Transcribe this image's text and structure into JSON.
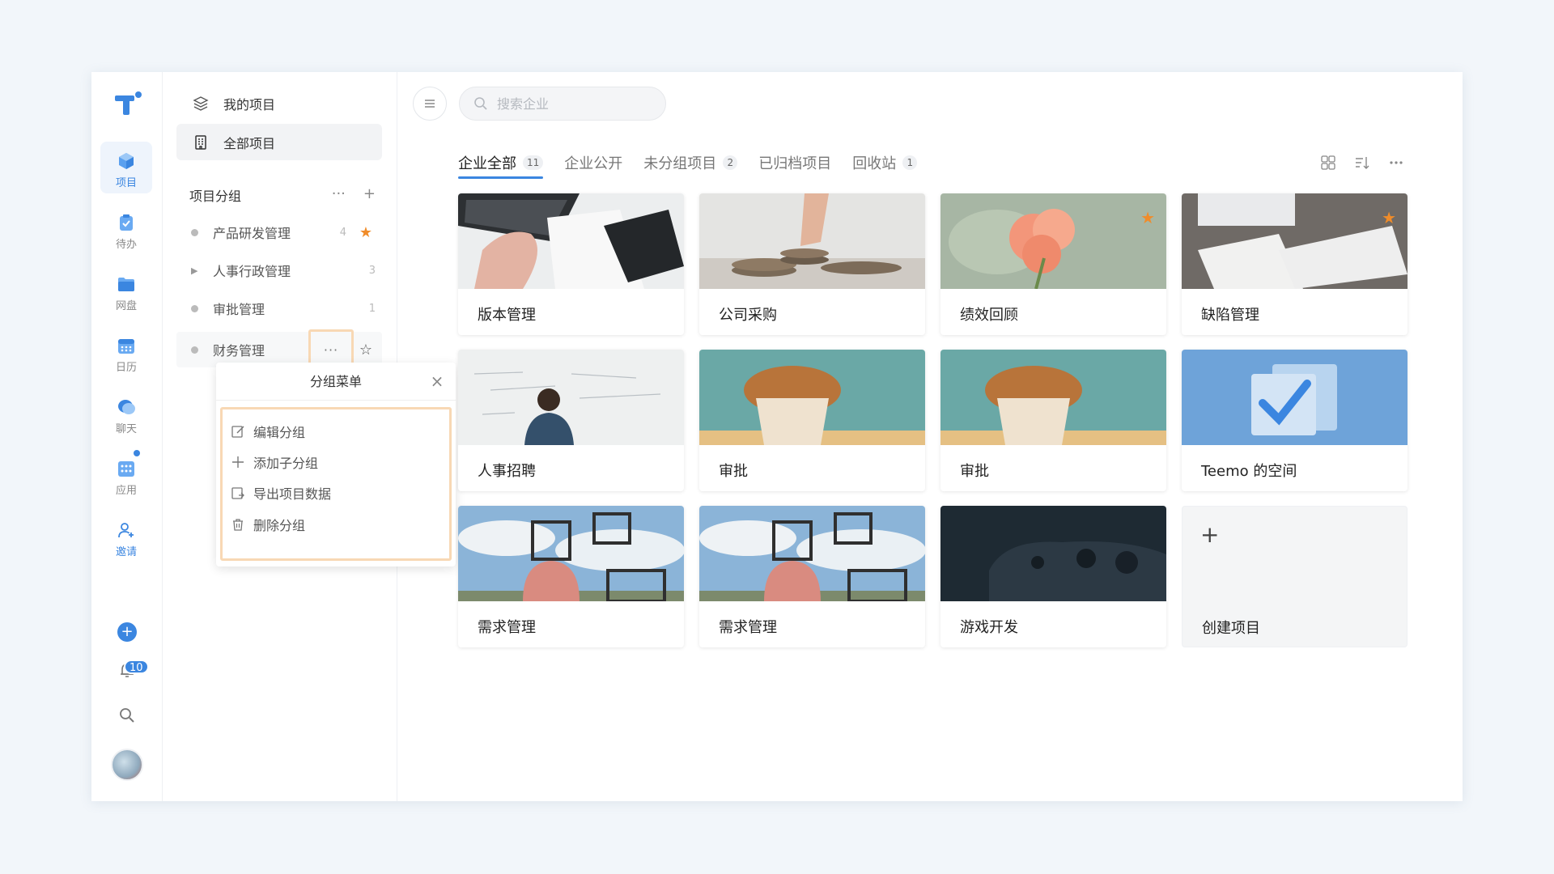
{
  "rail": {
    "items": [
      {
        "label": "项目"
      },
      {
        "label": "待办"
      },
      {
        "label": "网盘"
      },
      {
        "label": "日历"
      },
      {
        "label": "聊天"
      },
      {
        "label": "应用"
      },
      {
        "label": "邀请"
      }
    ],
    "notification_count": "10"
  },
  "sidebar": {
    "my_projects": "我的项目",
    "all_projects": "全部项目",
    "group_header": "项目分组",
    "groups": [
      {
        "name": "产品研发管理",
        "count": "4"
      },
      {
        "name": "人事行政管理",
        "count": "3"
      },
      {
        "name": "审批管理",
        "count": "1"
      },
      {
        "name": "财务管理",
        "count": ""
      }
    ]
  },
  "popup": {
    "title": "分组菜单",
    "items": [
      {
        "label": "编辑分组"
      },
      {
        "label": "添加子分组"
      },
      {
        "label": "导出项目数据"
      },
      {
        "label": "删除分组"
      }
    ]
  },
  "main": {
    "search_placeholder": "搜索企业",
    "tabs": [
      {
        "label": "企业全部",
        "badge": "11"
      },
      {
        "label": "企业公开",
        "badge": ""
      },
      {
        "label": "未分组项目",
        "badge": "2"
      },
      {
        "label": "已归档项目",
        "badge": ""
      },
      {
        "label": "回收站",
        "badge": "1"
      }
    ],
    "cards": [
      {
        "title": "版本管理",
        "starred": false,
        "image": "laptop-notebook"
      },
      {
        "title": "公司采购",
        "starred": false,
        "image": "coins"
      },
      {
        "title": "绩效回顾",
        "starred": true,
        "image": "flower"
      },
      {
        "title": "缺陷管理",
        "starred": true,
        "image": "keyboard-desk"
      },
      {
        "title": "人事招聘",
        "starred": false,
        "image": "whiteboard"
      },
      {
        "title": "审批",
        "starred": false,
        "image": "muffin"
      },
      {
        "title": "审批",
        "starred": false,
        "image": "muffin"
      },
      {
        "title": "Teemo 的空间",
        "starred": false,
        "image": "checkmark"
      },
      {
        "title": "需求管理",
        "starred": false,
        "image": "frames-sky"
      },
      {
        "title": "需求管理",
        "starred": false,
        "image": "frames-sky"
      },
      {
        "title": "游戏开发",
        "starred": false,
        "image": "gamepad"
      }
    ],
    "create_label": "创建项目"
  },
  "colors": {
    "accent": "#3b86e0",
    "star": "#f08c2a",
    "highlight_border": "#f8d8b4"
  }
}
